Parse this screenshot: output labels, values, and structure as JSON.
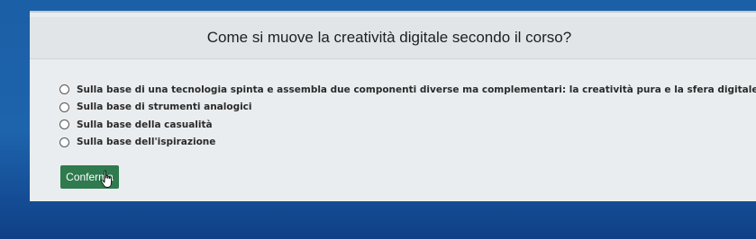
{
  "question": {
    "text": "Come si muove la creatività digitale secondo il corso?"
  },
  "options": [
    {
      "label": "Sulla base di una tecnologia spinta e assembla due componenti diverse ma complementari: la creatività pura e la sfera digitale",
      "selected": false
    },
    {
      "label": "Sulla base di strumenti analogici",
      "selected": false
    },
    {
      "label": "Sulla base della casualità",
      "selected": false
    },
    {
      "label": "Sulla base dell'ispirazione",
      "selected": false
    }
  ],
  "confirm_button": {
    "label": "Conferma",
    "color": "#2f7a4e"
  },
  "cursor": {
    "icon": "hand-pointer-icon"
  }
}
